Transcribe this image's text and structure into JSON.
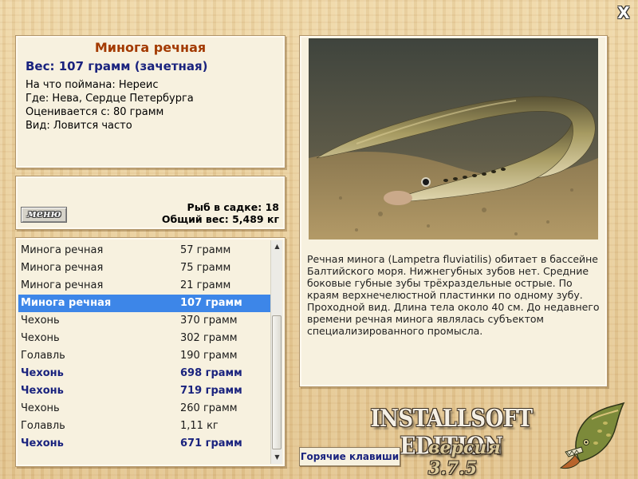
{
  "close_label": "X",
  "fish": {
    "name": "Минога речная",
    "weight_line": "Вес: 107 грамм (зачетная)",
    "bait": "На что поймана: Нереис",
    "location": "Где: Нева, Сердце Петербурга",
    "value": "Оценивается с: 80 грамм",
    "frequency": "Вид: Ловится часто"
  },
  "summary": {
    "menu_label": "меню",
    "fish_count": "Рыб в садке: 18",
    "total_weight": "Общий вес: 5,489 кг"
  },
  "catch_list": [
    {
      "name": "Минога речная",
      "weight": "57 грамм",
      "state": "normal"
    },
    {
      "name": "Минога речная",
      "weight": "75 грамм",
      "state": "normal"
    },
    {
      "name": "Минога речная",
      "weight": "21 грамм",
      "state": "normal"
    },
    {
      "name": "Минога речная",
      "weight": "107 грамм",
      "state": "selected"
    },
    {
      "name": "Чехонь",
      "weight": "370 грамм",
      "state": "normal"
    },
    {
      "name": "Чехонь",
      "weight": "302 грамм",
      "state": "normal"
    },
    {
      "name": "Голавль",
      "weight": "190 грамм",
      "state": "normal"
    },
    {
      "name": "Чехонь",
      "weight": "698 грамм",
      "state": "trophy"
    },
    {
      "name": "Чехонь",
      "weight": "719 грамм",
      "state": "trophy"
    },
    {
      "name": "Чехонь",
      "weight": "260 грамм",
      "state": "normal"
    },
    {
      "name": "Голавль",
      "weight": "1,11 кг",
      "state": "normal"
    },
    {
      "name": "Чехонь",
      "weight": "671 грамм",
      "state": "trophy"
    }
  ],
  "description": "Речная минога (Lampetra fluviatilis) обитает в бассейне Балтийского моря. Нижнегубных зубов нет. Средние боковые губные зубы трёхраздельные острые. По краям верхнечелюстной пластинки по одному зубу. Проходной вид. Длина тела около 40 см. До недавнего времени речная минога являлась субъектом специализированного промысла.",
  "hotkeys_label": "Горячие клавиши",
  "edition": {
    "title": "INSTALLSOFT EDITION",
    "version": "версия 3.7.5"
  },
  "colors": {
    "selected_row": "#3d86e8",
    "trophy_text": "#1a237e",
    "title_text": "#a33a00"
  },
  "icons": {
    "close": "close-icon",
    "scroll_up": "scroll-up-arrow-icon",
    "scroll_down": "scroll-down-arrow-icon",
    "logo": "pike-fish-logo-icon"
  }
}
